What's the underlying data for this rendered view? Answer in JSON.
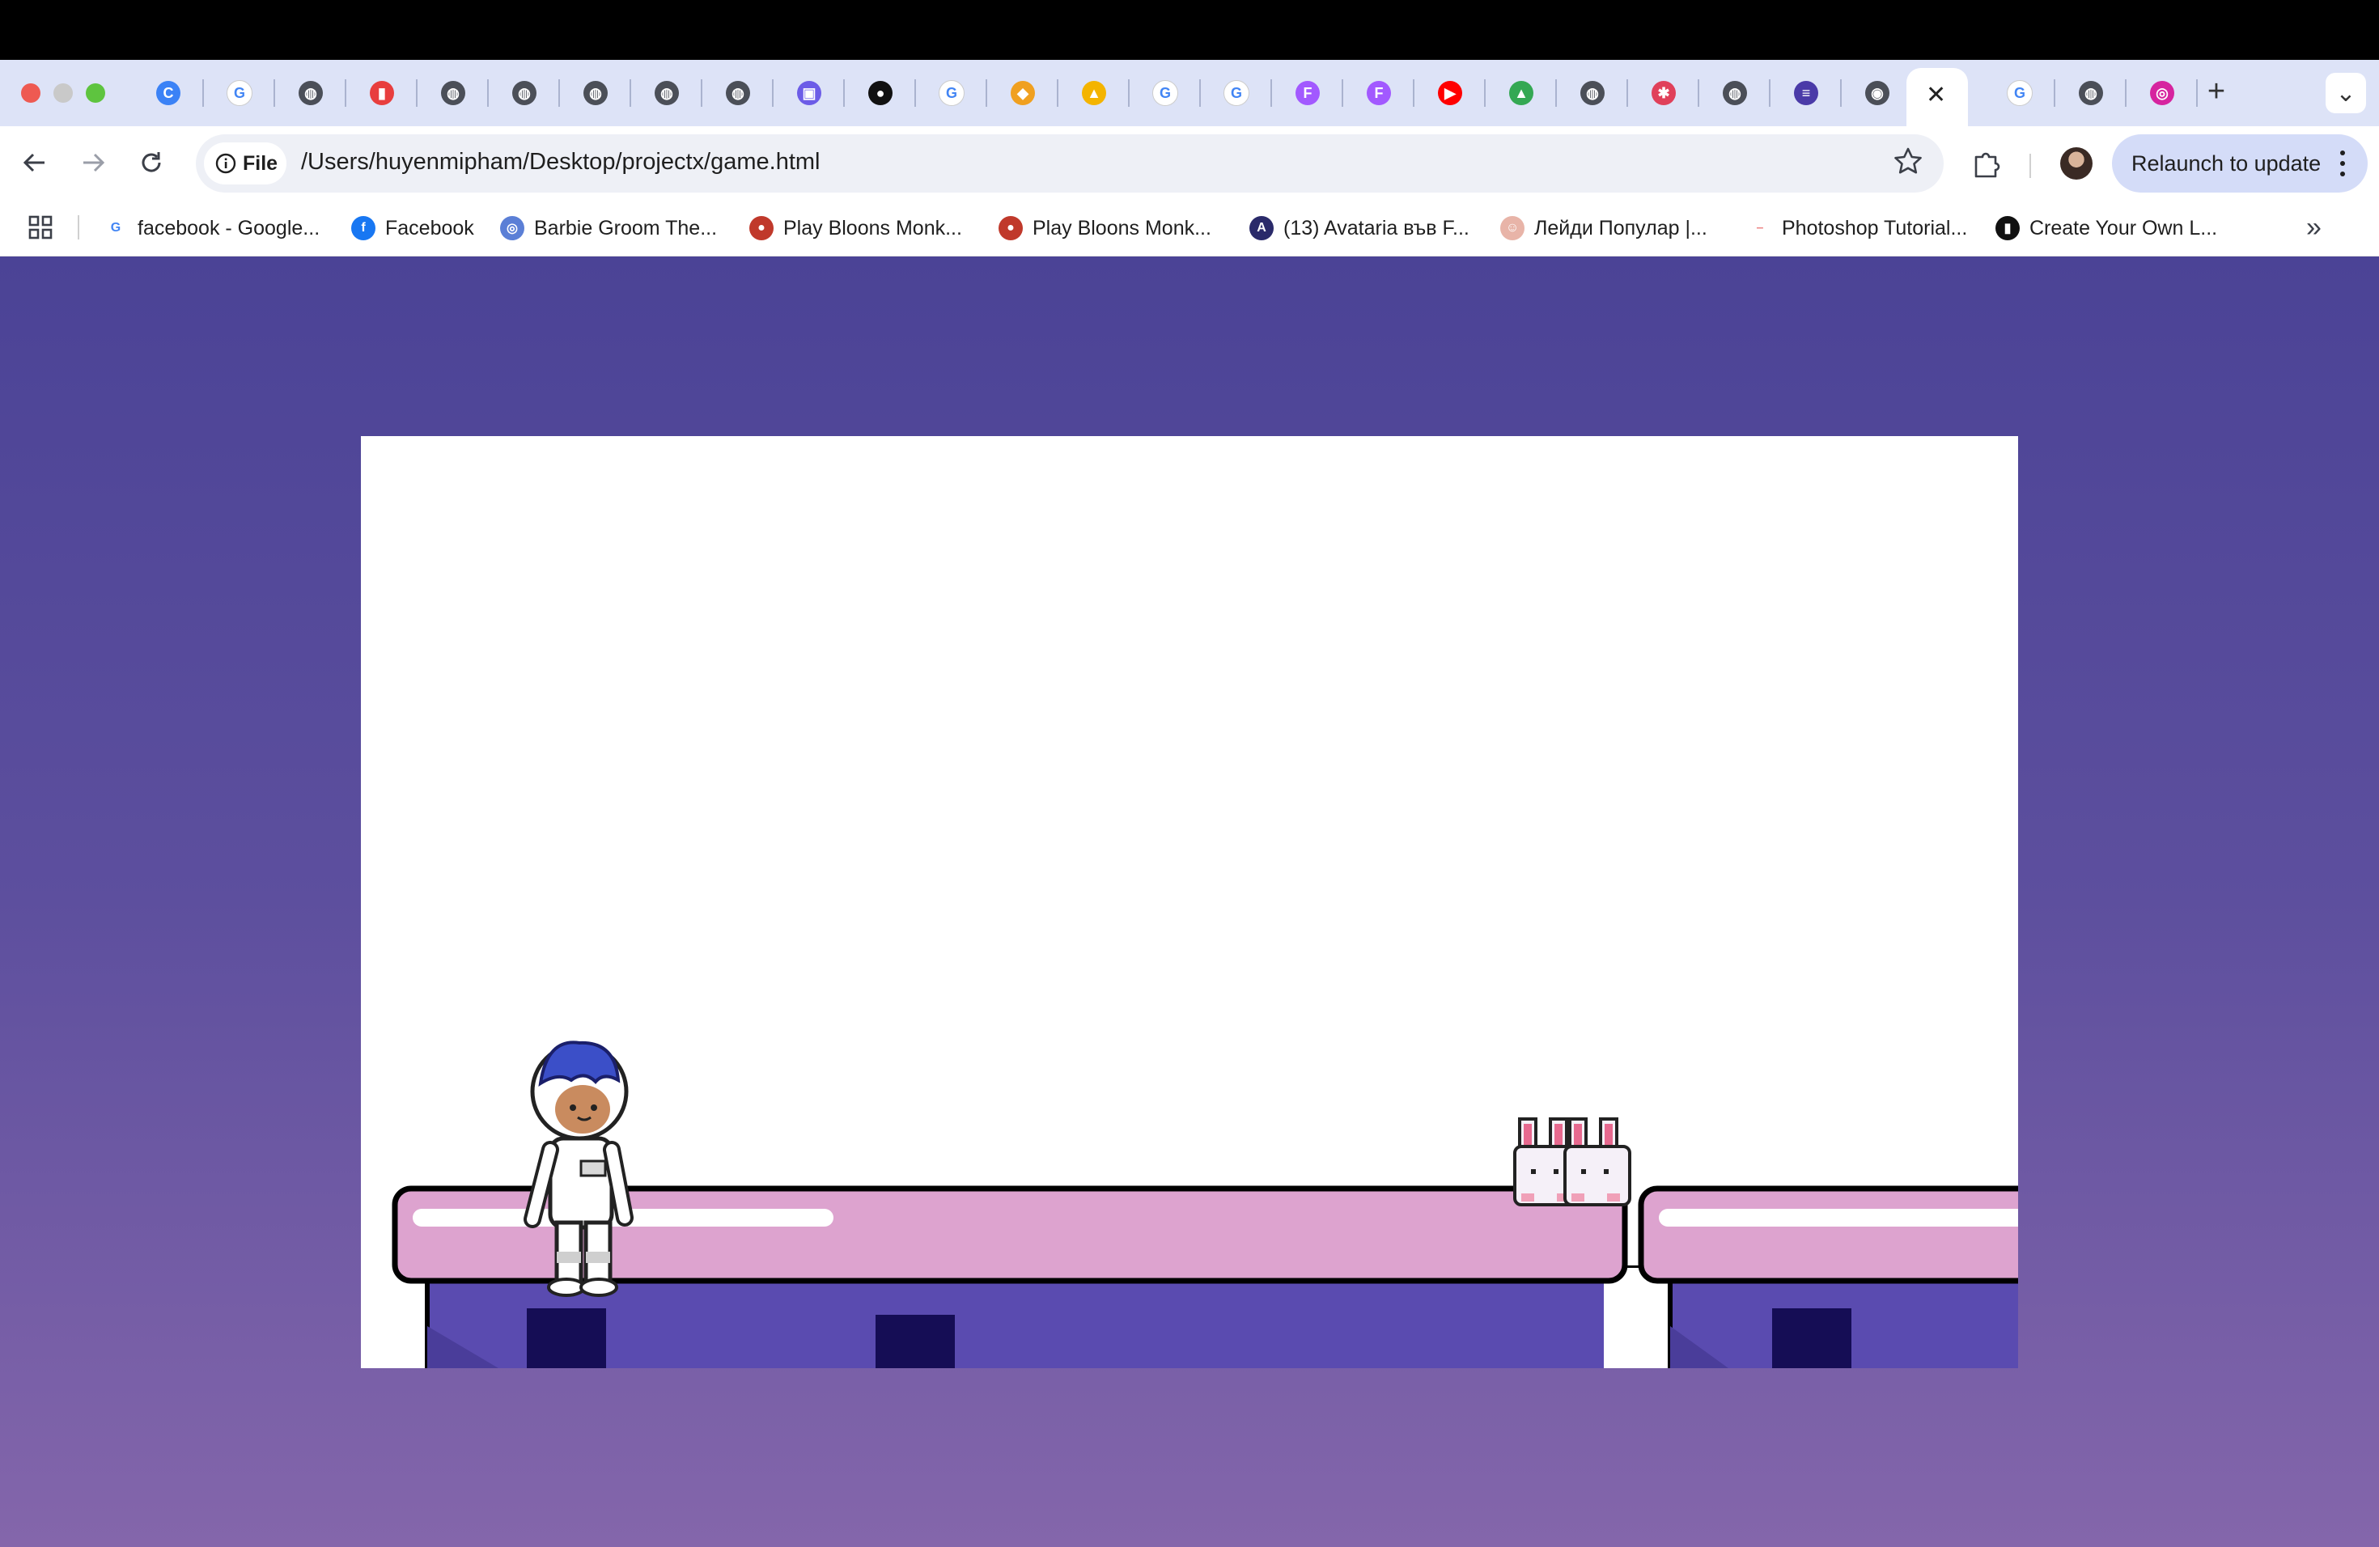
{
  "browser": {
    "tabs": [
      {
        "icon": "chromium-icon"
      },
      {
        "icon": "google-icon"
      },
      {
        "icon": "globe-icon"
      },
      {
        "icon": "colorful-app-icon"
      },
      {
        "icon": "globe-icon"
      },
      {
        "icon": "globe-icon"
      },
      {
        "icon": "globe-icon"
      },
      {
        "icon": "globe-icon"
      },
      {
        "icon": "globe-icon"
      },
      {
        "icon": "calendar-app-icon"
      },
      {
        "icon": "github-icon"
      },
      {
        "icon": "google-icon"
      },
      {
        "icon": "cube-icon"
      },
      {
        "icon": "graduation-cap-icon"
      },
      {
        "icon": "google-icon"
      },
      {
        "icon": "google-icon"
      },
      {
        "icon": "figma-icon"
      },
      {
        "icon": "figma-icon"
      },
      {
        "icon": "youtube-icon"
      },
      {
        "icon": "google-drive-icon"
      },
      {
        "icon": "globe-icon"
      },
      {
        "icon": "red-badge-icon"
      },
      {
        "icon": "globe-icon"
      },
      {
        "icon": "list-app-icon"
      },
      {
        "icon": "chrome-icon"
      },
      {
        "icon": "close-icon",
        "active": true
      },
      {
        "icon": "google-icon"
      },
      {
        "icon": "globe-icon"
      },
      {
        "icon": "instagram-icon"
      }
    ],
    "new_tab_symbol": "+",
    "tab_search_symbol": "⌄",
    "file_chip_label": "File",
    "url": "/Users/huyenmipham/Desktop/projectx/game.html",
    "relaunch_label": "Relaunch to update",
    "bookmarks": [
      {
        "label": "facebook - Google...",
        "icon": "google-icon"
      },
      {
        "label": "Facebook",
        "icon": "facebook-icon"
      },
      {
        "label": "Barbie Groom The...",
        "icon": "barbie-icon"
      },
      {
        "label": "Play Bloons Monk...",
        "icon": "bloons-icon"
      },
      {
        "label": "Play Bloons Monk...",
        "icon": "bloons-icon"
      },
      {
        "label": "(13) Avataria във F...",
        "icon": "avataria-icon"
      },
      {
        "label": "Лейди Популар |...",
        "icon": "lady-popular-icon"
      },
      {
        "label": "Photoshop Tutorial...",
        "icon": "dash-icon"
      },
      {
        "label": "Create Your Own L...",
        "icon": "logo-maker-icon"
      }
    ],
    "bookmarks_overflow": "»"
  },
  "colors": {
    "page_top": "#4b4396",
    "page_bottom": "#8466ab",
    "platform_pink": "#dda3cf",
    "building_purple": "#5a4bb0",
    "window_navy": "#150d55"
  },
  "game": {
    "player": "astronaut",
    "enemy": "bunnies",
    "enemy_count": 2
  }
}
